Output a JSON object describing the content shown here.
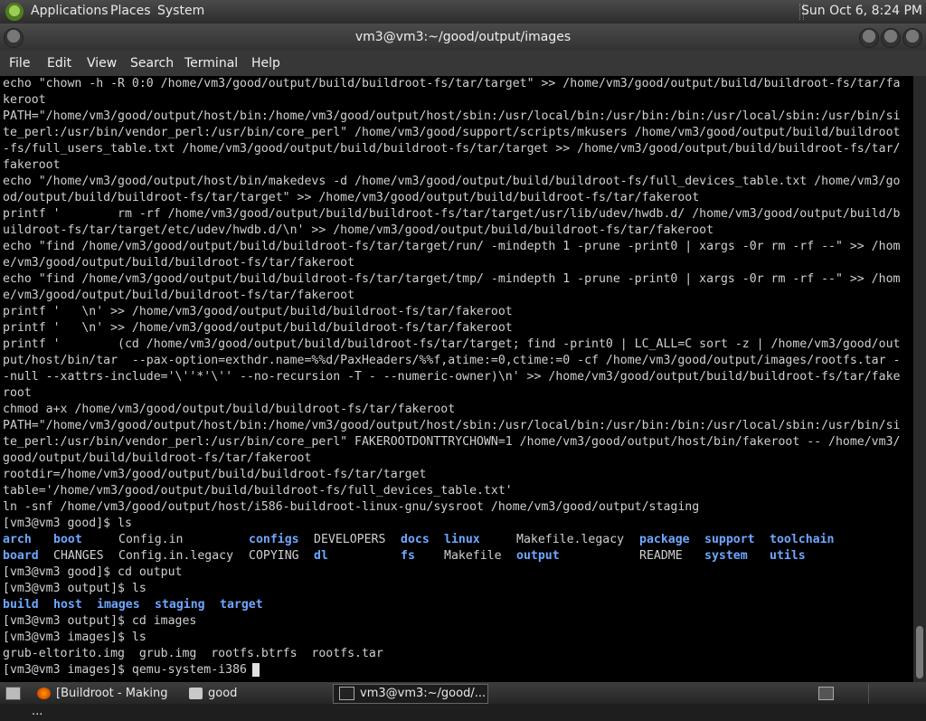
{
  "top_panel": {
    "applications": "Applications",
    "places": "Places",
    "system": "System",
    "clock": "Sun Oct  6,  8:24 PM"
  },
  "window": {
    "title": "vm3@vm3:~/good/output/images"
  },
  "menu": [
    "File",
    "Edit",
    "View",
    "Search",
    "Terminal",
    "Help"
  ],
  "terminal": {
    "lines": [
      "echo \"chown -h -R 0:0 /home/vm3/good/output/build/buildroot-fs/tar/target\" >> /home/vm3/good/output/build/buildroot-fs/tar/fa",
      "keroot",
      "PATH=\"/home/vm3/good/output/host/bin:/home/vm3/good/output/host/sbin:/usr/local/bin:/usr/bin:/bin:/usr/local/sbin:/usr/bin/si",
      "te_perl:/usr/bin/vendor_perl:/usr/bin/core_perl\" /home/vm3/good/support/scripts/mkusers /home/vm3/good/output/build/buildroot",
      "-fs/full_users_table.txt /home/vm3/good/output/build/buildroot-fs/tar/target >> /home/vm3/good/output/build/buildroot-fs/tar/",
      "fakeroot",
      "echo \"/home/vm3/good/output/host/bin/makedevs -d /home/vm3/good/output/build/buildroot-fs/full_devices_table.txt /home/vm3/go",
      "od/output/build/buildroot-fs/tar/target\" >> /home/vm3/good/output/build/buildroot-fs/tar/fakeroot",
      "printf '        rm -rf /home/vm3/good/output/build/buildroot-fs/tar/target/usr/lib/udev/hwdb.d/ /home/vm3/good/output/build/b",
      "uildroot-fs/tar/target/etc/udev/hwdb.d/\\n' >> /home/vm3/good/output/build/buildroot-fs/tar/fakeroot",
      "echo \"find /home/vm3/good/output/build/buildroot-fs/tar/target/run/ -mindepth 1 -prune -print0 | xargs -0r rm -rf --\" >> /hom",
      "e/vm3/good/output/build/buildroot-fs/tar/fakeroot",
      "echo \"find /home/vm3/good/output/build/buildroot-fs/tar/target/tmp/ -mindepth 1 -prune -print0 | xargs -0r rm -rf --\" >> /hom",
      "e/vm3/good/output/build/buildroot-fs/tar/fakeroot",
      "printf '   \\n' >> /home/vm3/good/output/build/buildroot-fs/tar/fakeroot",
      "printf '   \\n' >> /home/vm3/good/output/build/buildroot-fs/tar/fakeroot",
      "printf '        (cd /home/vm3/good/output/build/buildroot-fs/tar/target; find -print0 | LC_ALL=C sort -z | /home/vm3/good/out",
      "put/host/bin/tar  --pax-option=exthdr.name=%%d/PaxHeaders/%%f,atime:=0,ctime:=0 -cf /home/vm3/good/output/images/rootfs.tar -",
      "-null --xattrs-include='\\''*'\\'' --no-recursion -T - --numeric-owner)\\n' >> /home/vm3/good/output/build/buildroot-fs/tar/fake",
      "root",
      "chmod a+x /home/vm3/good/output/build/buildroot-fs/tar/fakeroot",
      "PATH=\"/home/vm3/good/output/host/bin:/home/vm3/good/output/host/sbin:/usr/local/bin:/usr/bin:/bin:/usr/local/sbin:/usr/bin/si",
      "te_perl:/usr/bin/vendor_perl:/usr/bin/core_perl\" FAKEROOTDONTTRYCHOWN=1 /home/vm3/good/output/host/bin/fakeroot -- /home/vm3/",
      "good/output/build/buildroot-fs/tar/fakeroot",
      "rootdir=/home/vm3/good/output/build/buildroot-fs/tar/target",
      "table='/home/vm3/good/output/build/buildroot-fs/full_devices_table.txt'",
      "ln -snf /home/vm3/good/output/host/i586-buildroot-linux-gnu/sysroot /home/vm3/good/output/staging",
      "[vm3@vm3 good]$ ls"
    ],
    "ls_good": [
      [
        {
          "text": "arch",
          "dir": true
        },
        {
          "text": "boot",
          "dir": true
        },
        {
          "text": "Config.in",
          "dir": false
        },
        {
          "text": "configs",
          "dir": true
        },
        {
          "text": "DEVELOPERS",
          "dir": false
        },
        {
          "text": "docs",
          "dir": true
        },
        {
          "text": "linux",
          "dir": true
        },
        {
          "text": "Makefile.legacy",
          "dir": false
        },
        {
          "text": "package",
          "dir": true
        },
        {
          "text": "support",
          "dir": true
        },
        {
          "text": "toolchain",
          "dir": true
        }
      ],
      [
        {
          "text": "board",
          "dir": true
        },
        {
          "text": "CHANGES",
          "dir": false
        },
        {
          "text": "Config.in.legacy",
          "dir": false
        },
        {
          "text": "COPYING",
          "dir": false
        },
        {
          "text": "dl",
          "dir": true
        },
        {
          "text": "fs",
          "dir": true
        },
        {
          "text": "Makefile",
          "dir": false
        },
        {
          "text": "output",
          "dir": true
        },
        {
          "text": "README",
          "dir": false
        },
        {
          "text": "system",
          "dir": true
        },
        {
          "text": "utils",
          "dir": true
        }
      ]
    ],
    "after_lines": [
      "[vm3@vm3 good]$ cd output",
      "[vm3@vm3 output]$ ls"
    ],
    "ls_output": [
      {
        "text": "build"
      },
      {
        "text": "host"
      },
      {
        "text": "images"
      },
      {
        "text": "staging"
      },
      {
        "text": "target"
      }
    ],
    "after_lines2": [
      "[vm3@vm3 output]$ cd images",
      "[vm3@vm3 images]$ ls",
      "grub-eltorito.img  grub.img  rootfs.btrfs  rootfs.tar"
    ],
    "prompt": "[vm3@vm3 images]$ qemu-system-i386"
  },
  "taskbar": {
    "items": [
      {
        "label": "[Buildroot - Making ..."
      },
      {
        "label": "good"
      },
      {
        "label": "vm3@vm3:~/good/..."
      }
    ]
  }
}
